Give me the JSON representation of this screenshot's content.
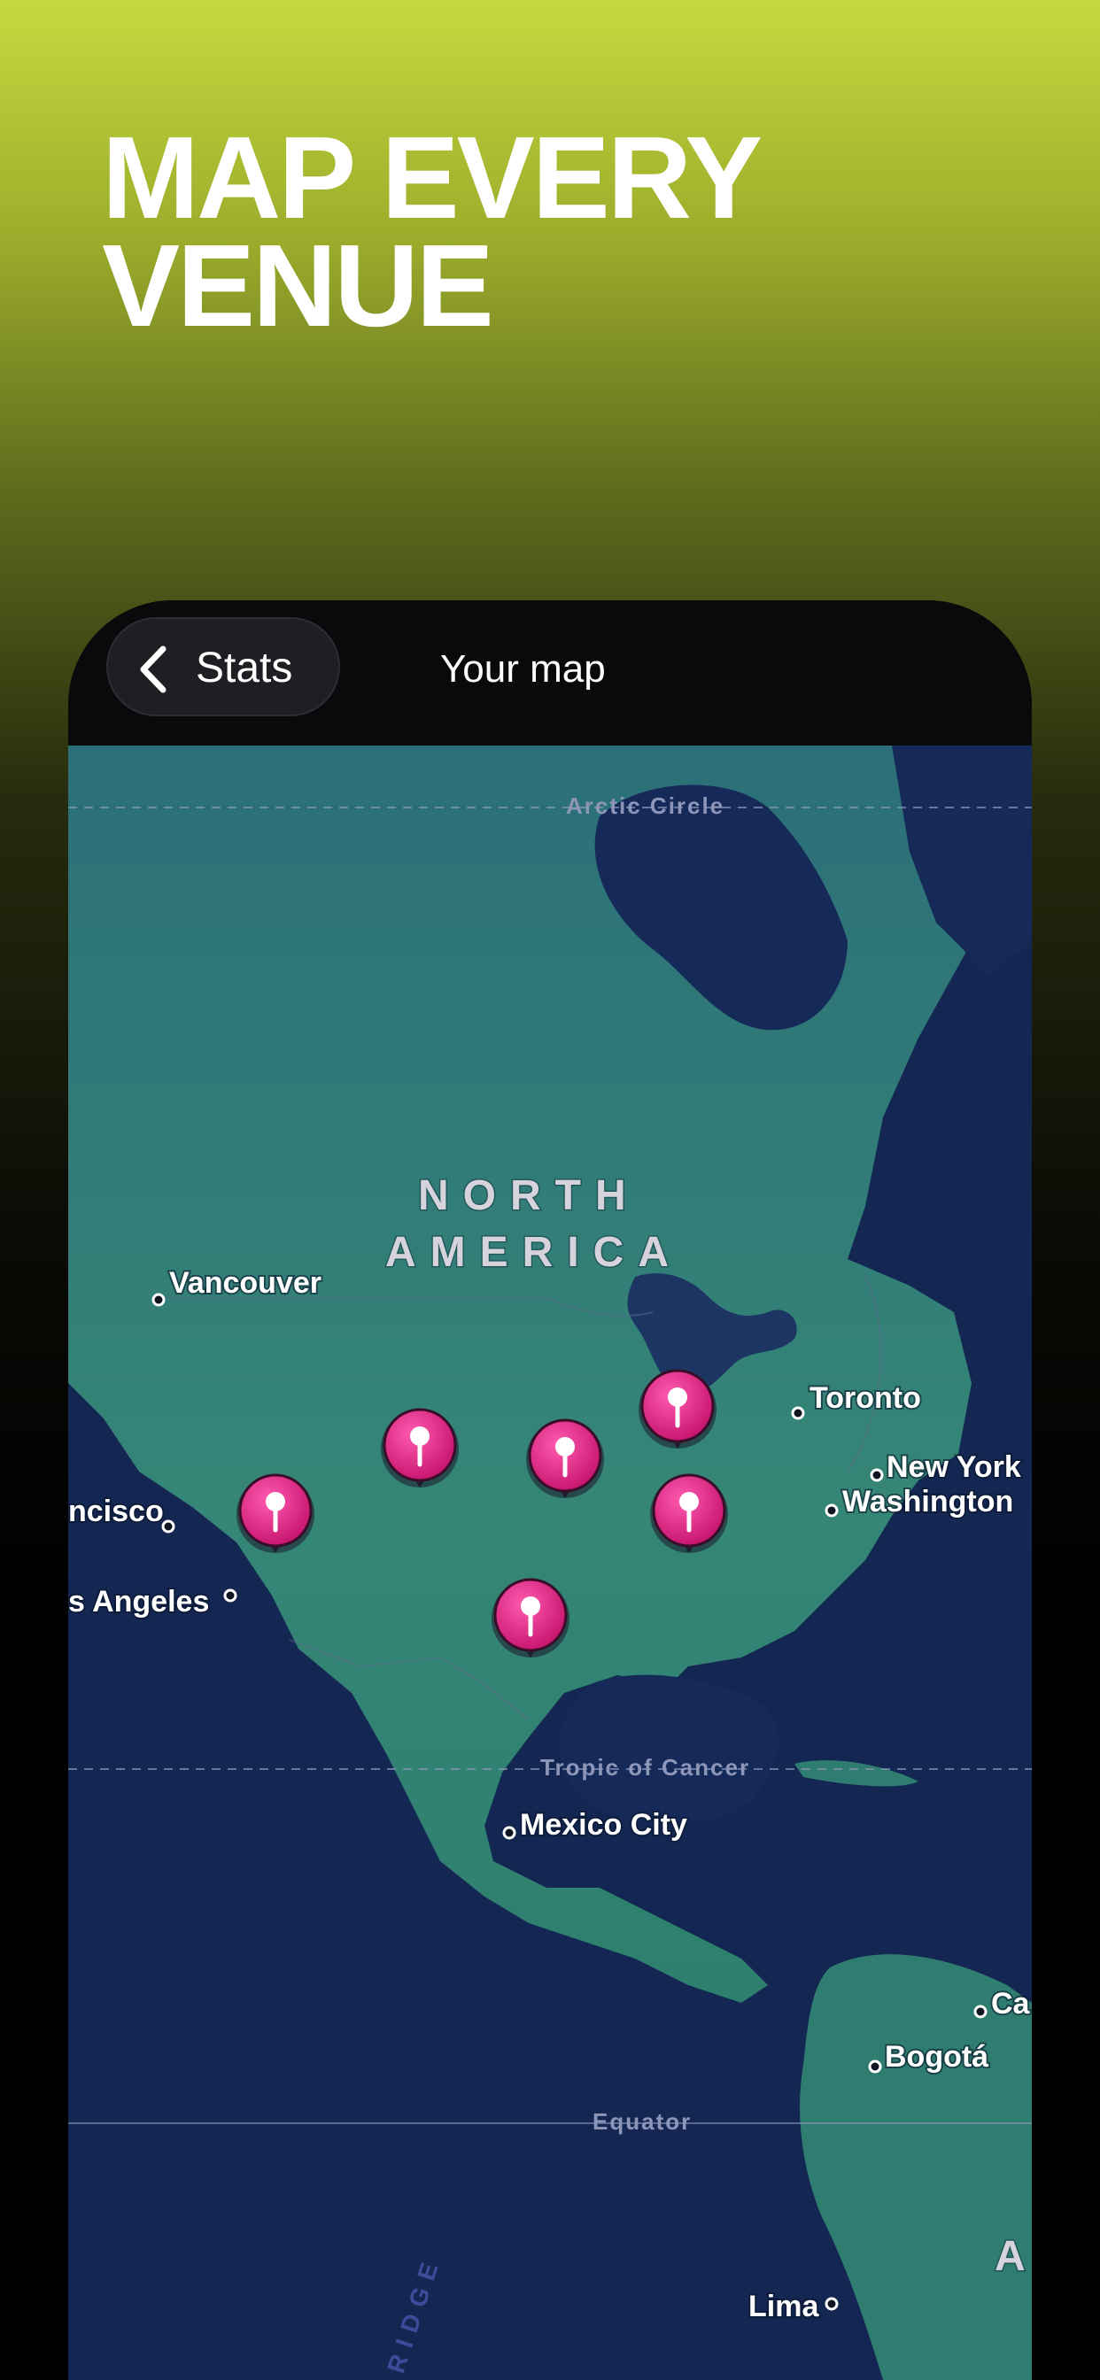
{
  "headline": {
    "line1": "MAP EVERY",
    "line2": "VENUE"
  },
  "navbar": {
    "back_label": "Stats",
    "title": "Your map"
  },
  "map": {
    "region_label_line1": "NORTH",
    "region_label_line2": "AMERICA",
    "latitude_lines": {
      "arctic": "Arctic Circle",
      "tropic": "Tropic of Cancer",
      "equator": "Equator"
    },
    "ocean_feature_label": "RIDGE",
    "cities": {
      "vancouver": "Vancouver",
      "toronto": "Toronto",
      "new_york": "New York",
      "washington": "Washington",
      "san_francisco": "ncisco",
      "los_angeles": "s Angeles",
      "mexico_city": "Mexico City",
      "bogota": "Bogotá",
      "lima": "Lima",
      "caracas": "Ca",
      "edge_letter": "A"
    },
    "pins": [
      "venue-pin",
      "venue-pin",
      "venue-pin",
      "venue-pin",
      "venue-pin",
      "venue-pin"
    ]
  },
  "colors": {
    "pin": "#e8268a",
    "land": "#2e7f7c",
    "ocean": "#162a55",
    "accent_top": "#c5d93e"
  }
}
